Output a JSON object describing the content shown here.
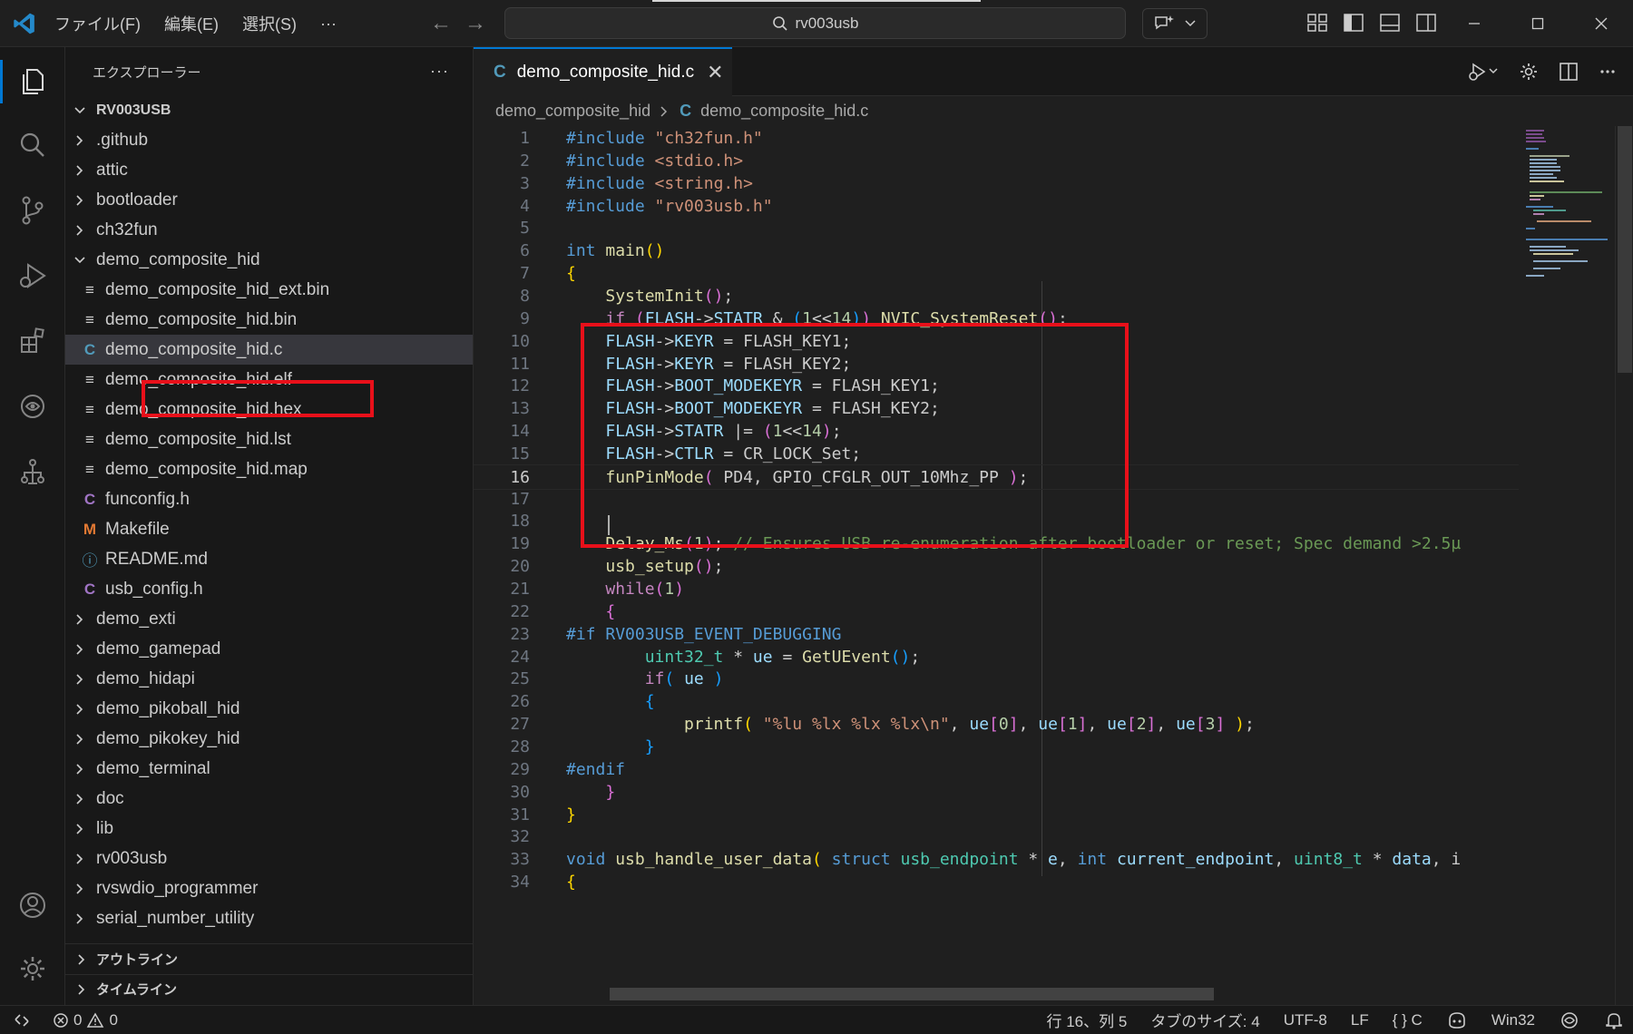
{
  "titlebar": {
    "menu": [
      "ファイル(F)",
      "編集(E)",
      "選択(S)",
      "···"
    ],
    "search_text": "rv003usb"
  },
  "sidebar": {
    "title": "エクスプローラー",
    "more": "···",
    "root": "RV003USB",
    "items": [
      {
        "label": ".github",
        "kind": "folder",
        "depth": 1,
        "expanded": false
      },
      {
        "label": "attic",
        "kind": "folder",
        "depth": 1,
        "expanded": false
      },
      {
        "label": "bootloader",
        "kind": "folder",
        "depth": 1,
        "expanded": false
      },
      {
        "label": "ch32fun",
        "kind": "folder",
        "depth": 1,
        "expanded": false
      },
      {
        "label": "demo_composite_hid",
        "kind": "folder",
        "depth": 1,
        "expanded": true
      },
      {
        "label": "demo_composite_hid_ext.bin",
        "kind": "file-lines",
        "depth": 2
      },
      {
        "label": "demo_composite_hid.bin",
        "kind": "file-lines",
        "depth": 2
      },
      {
        "label": "demo_composite_hid.c",
        "kind": "file-c",
        "depth": 2,
        "selected": true
      },
      {
        "label": "demo_composite_hid.elf",
        "kind": "file-lines",
        "depth": 2
      },
      {
        "label": "demo_composite_hid.hex",
        "kind": "file-lines",
        "depth": 2
      },
      {
        "label": "demo_composite_hid.lst",
        "kind": "file-lines",
        "depth": 2
      },
      {
        "label": "demo_composite_hid.map",
        "kind": "file-lines",
        "depth": 2
      },
      {
        "label": "funconfig.h",
        "kind": "file-h",
        "depth": 2
      },
      {
        "label": "Makefile",
        "kind": "file-make",
        "depth": 2
      },
      {
        "label": "README.md",
        "kind": "file-info",
        "depth": 2
      },
      {
        "label": "usb_config.h",
        "kind": "file-h",
        "depth": 2
      },
      {
        "label": "demo_exti",
        "kind": "folder",
        "depth": 1,
        "expanded": false
      },
      {
        "label": "demo_gamepad",
        "kind": "folder",
        "depth": 1,
        "expanded": false
      },
      {
        "label": "demo_hidapi",
        "kind": "folder",
        "depth": 1,
        "expanded": false
      },
      {
        "label": "demo_pikoball_hid",
        "kind": "folder",
        "depth": 1,
        "expanded": false
      },
      {
        "label": "demo_pikokey_hid",
        "kind": "folder",
        "depth": 1,
        "expanded": false
      },
      {
        "label": "demo_terminal",
        "kind": "folder",
        "depth": 1,
        "expanded": false
      },
      {
        "label": "doc",
        "kind": "folder",
        "depth": 1,
        "expanded": false
      },
      {
        "label": "lib",
        "kind": "folder",
        "depth": 1,
        "expanded": false
      },
      {
        "label": "rv003usb",
        "kind": "folder",
        "depth": 1,
        "expanded": false
      },
      {
        "label": "rvswdio_programmer",
        "kind": "folder",
        "depth": 1,
        "expanded": false
      },
      {
        "label": "serial_number_utility",
        "kind": "folder",
        "depth": 1,
        "expanded": false
      }
    ],
    "outline_label": "アウトライン",
    "timeline_label": "タイムライン"
  },
  "editor": {
    "tab_icon": "C",
    "tab_label": "demo_composite_hid.c",
    "tab_close": "✕",
    "breadcrumb": [
      "demo_composite_hid",
      "demo_composite_hid.c"
    ],
    "current_line": 16,
    "lines": [
      [
        [
          "pp",
          "#include "
        ],
        [
          "str",
          "\"ch32fun.h\""
        ]
      ],
      [
        [
          "pp",
          "#include "
        ],
        [
          "str",
          "<stdio.h>"
        ]
      ],
      [
        [
          "pp",
          "#include "
        ],
        [
          "str",
          "<string.h>"
        ]
      ],
      [
        [
          "pp",
          "#include "
        ],
        [
          "str",
          "\"rv003usb.h\""
        ]
      ],
      [],
      [
        [
          "kw",
          "int "
        ],
        [
          "fn",
          "main"
        ],
        [
          "br1",
          "()"
        ]
      ],
      [
        [
          "br1",
          "{"
        ]
      ],
      [
        [
          "t",
          "    "
        ],
        [
          "fn",
          "SystemInit"
        ],
        [
          "br2",
          "()"
        ],
        [
          "t",
          ";"
        ]
      ],
      [
        [
          "t",
          "    "
        ],
        [
          "ctl",
          "if "
        ],
        [
          "br2",
          "("
        ],
        [
          "var",
          "FLASH"
        ],
        [
          "t",
          "->"
        ],
        [
          "var",
          "STATR"
        ],
        [
          "t",
          " & "
        ],
        [
          "br3",
          "("
        ],
        [
          "num",
          "1"
        ],
        [
          "t",
          "<<"
        ],
        [
          "num",
          "14"
        ],
        [
          "br3",
          ")"
        ],
        [
          "br2",
          ")"
        ],
        [
          "t",
          " "
        ],
        [
          "fn",
          "NVIC_SystemReset"
        ],
        [
          "br2",
          "()"
        ],
        [
          "t",
          ";"
        ]
      ],
      [
        [
          "t",
          "    "
        ],
        [
          "var",
          "FLASH"
        ],
        [
          "t",
          "->"
        ],
        [
          "var",
          "KEYR"
        ],
        [
          "t",
          " = FLASH_KEY1;"
        ]
      ],
      [
        [
          "t",
          "    "
        ],
        [
          "var",
          "FLASH"
        ],
        [
          "t",
          "->"
        ],
        [
          "var",
          "KEYR"
        ],
        [
          "t",
          " = FLASH_KEY2;"
        ]
      ],
      [
        [
          "t",
          "    "
        ],
        [
          "var",
          "FLASH"
        ],
        [
          "t",
          "->"
        ],
        [
          "var",
          "BOOT_MODEKEYR"
        ],
        [
          "t",
          " = FLASH_KEY1;"
        ]
      ],
      [
        [
          "t",
          "    "
        ],
        [
          "var",
          "FLASH"
        ],
        [
          "t",
          "->"
        ],
        [
          "var",
          "BOOT_MODEKEYR"
        ],
        [
          "t",
          " = FLASH_KEY2;"
        ]
      ],
      [
        [
          "t",
          "    "
        ],
        [
          "var",
          "FLASH"
        ],
        [
          "t",
          "->"
        ],
        [
          "var",
          "STATR"
        ],
        [
          "t",
          " |= "
        ],
        [
          "br2",
          "("
        ],
        [
          "num",
          "1"
        ],
        [
          "t",
          "<<"
        ],
        [
          "num",
          "14"
        ],
        [
          "br2",
          ")"
        ],
        [
          "t",
          ";"
        ]
      ],
      [
        [
          "t",
          "    "
        ],
        [
          "var",
          "FLASH"
        ],
        [
          "t",
          "->"
        ],
        [
          "var",
          "CTLR"
        ],
        [
          "t",
          " = CR_LOCK_Set;"
        ]
      ],
      [
        [
          "t",
          "    "
        ],
        [
          "fn",
          "funPinMode"
        ],
        [
          "br2",
          "("
        ],
        [
          "t",
          " PD4, GPIO_CFGLR_OUT_10Mhz_PP "
        ],
        [
          "br2",
          ")"
        ],
        [
          "t",
          ";"
        ]
      ],
      [],
      [],
      [
        [
          "t",
          "    "
        ],
        [
          "fn",
          "Delay_Ms"
        ],
        [
          "br2",
          "("
        ],
        [
          "num",
          "1"
        ],
        [
          "br2",
          ")"
        ],
        [
          "t",
          "; "
        ],
        [
          "com",
          "// Ensures USB re-enumeration after bootloader or reset; Spec demand >2.5µ"
        ]
      ],
      [
        [
          "t",
          "    "
        ],
        [
          "fn",
          "usb_setup"
        ],
        [
          "br2",
          "()"
        ],
        [
          "t",
          ";"
        ]
      ],
      [
        [
          "t",
          "    "
        ],
        [
          "ctl",
          "while"
        ],
        [
          "br2",
          "("
        ],
        [
          "num",
          "1"
        ],
        [
          "br2",
          ")"
        ]
      ],
      [
        [
          "t",
          "    "
        ],
        [
          "br2",
          "{"
        ]
      ],
      [
        [
          "pp",
          "#if "
        ],
        [
          "mac",
          "RV003USB_EVENT_DEBUGGING"
        ]
      ],
      [
        [
          "t",
          "        "
        ],
        [
          "type",
          "uint32_t"
        ],
        [
          "t",
          " * "
        ],
        [
          "var",
          "ue"
        ],
        [
          "t",
          " = "
        ],
        [
          "fn",
          "GetUEvent"
        ],
        [
          "br3",
          "()"
        ],
        [
          "t",
          ";"
        ]
      ],
      [
        [
          "t",
          "        "
        ],
        [
          "ctl",
          "if"
        ],
        [
          "br3",
          "("
        ],
        [
          "t",
          " "
        ],
        [
          "var",
          "ue"
        ],
        [
          "t",
          " "
        ],
        [
          "br3",
          ")"
        ]
      ],
      [
        [
          "t",
          "        "
        ],
        [
          "br3",
          "{"
        ]
      ],
      [
        [
          "t",
          "            "
        ],
        [
          "fn",
          "printf"
        ],
        [
          "br1",
          "("
        ],
        [
          "t",
          " "
        ],
        [
          "str",
          "\"%lu %lx %lx %lx\\n\""
        ],
        [
          "t",
          ", "
        ],
        [
          "var",
          "ue"
        ],
        [
          "br2",
          "["
        ],
        [
          "num",
          "0"
        ],
        [
          "br2",
          "]"
        ],
        [
          "t",
          ", "
        ],
        [
          "var",
          "ue"
        ],
        [
          "br2",
          "["
        ],
        [
          "num",
          "1"
        ],
        [
          "br2",
          "]"
        ],
        [
          "t",
          ", "
        ],
        [
          "var",
          "ue"
        ],
        [
          "br2",
          "["
        ],
        [
          "num",
          "2"
        ],
        [
          "br2",
          "]"
        ],
        [
          "t",
          ", "
        ],
        [
          "var",
          "ue"
        ],
        [
          "br2",
          "["
        ],
        [
          "num",
          "3"
        ],
        [
          "br2",
          "]"
        ],
        [
          "t",
          " "
        ],
        [
          "br1",
          ")"
        ],
        [
          "t",
          ";"
        ]
      ],
      [
        [
          "t",
          "        "
        ],
        [
          "br3",
          "}"
        ]
      ],
      [
        [
          "pp",
          "#endif"
        ]
      ],
      [
        [
          "t",
          "    "
        ],
        [
          "br2",
          "}"
        ]
      ],
      [
        [
          "br1",
          "}"
        ]
      ],
      [],
      [
        [
          "kw",
          "void "
        ],
        [
          "fn",
          "usb_handle_user_data"
        ],
        [
          "br1",
          "("
        ],
        [
          "t",
          " "
        ],
        [
          "kw",
          "struct "
        ],
        [
          "type",
          "usb_endpoint"
        ],
        [
          "t",
          " * "
        ],
        [
          "var",
          "e"
        ],
        [
          "t",
          ", "
        ],
        [
          "kw",
          "int "
        ],
        [
          "var",
          "current_endpoint"
        ],
        [
          "t",
          ", "
        ],
        [
          "type",
          "uint8_t"
        ],
        [
          "t",
          " * "
        ],
        [
          "var",
          "data"
        ],
        [
          "t",
          ", i"
        ]
      ],
      [
        [
          "br1",
          "{"
        ]
      ]
    ]
  },
  "statusbar": {
    "errors": "0",
    "warnings": "0",
    "position": "行 16、列 5",
    "tab_size": "タブのサイズ: 4",
    "encoding": "UTF-8",
    "eol": "LF",
    "language": "{ }  C",
    "platform": "Win32"
  },
  "colors": {
    "accent": "#0078d4",
    "highlight_box": "#e8101a",
    "background": "#1f1f1f"
  }
}
